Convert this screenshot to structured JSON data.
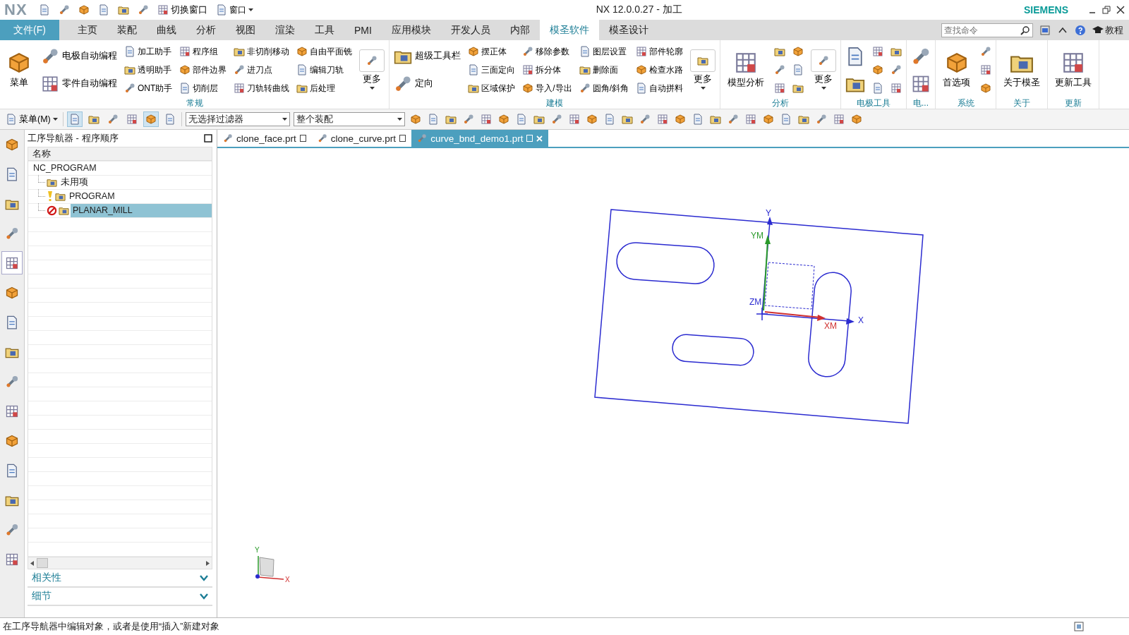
{
  "title_bar": {
    "logo": "NX",
    "switch_window": "切换窗口",
    "window_menu": "窗口",
    "title": "NX 12.0.0.27 - 加工",
    "brand": "SIEMENS"
  },
  "menu_bar": {
    "file": "文件(F)",
    "tabs": [
      {
        "label": "主页",
        "selected": false
      },
      {
        "label": "装配",
        "selected": false
      },
      {
        "label": "曲线",
        "selected": false
      },
      {
        "label": "分析",
        "selected": false
      },
      {
        "label": "视图",
        "selected": false
      },
      {
        "label": "渲染",
        "selected": false
      },
      {
        "label": "工具",
        "selected": false
      },
      {
        "label": "PMI",
        "selected": false
      },
      {
        "label": "应用模块",
        "selected": false
      },
      {
        "label": "开发人员",
        "selected": false
      },
      {
        "label": "内部",
        "selected": false
      },
      {
        "label": "模圣软件",
        "selected": true
      },
      {
        "label": "模圣设计",
        "selected": false
      }
    ],
    "search": {
      "placeholder": "查找命令"
    },
    "tutorial": "教程"
  },
  "ribbon": {
    "groups": [
      {
        "label": "常规",
        "columns": [
          [
            {
              "kind": "large",
              "label": "菜单"
            }
          ],
          [
            {
              "kind": "medium",
              "label": "电极自动编程"
            },
            {
              "kind": "medium",
              "label": "零件自动编程"
            }
          ],
          [
            {
              "kind": "small",
              "label": "加工助手"
            },
            {
              "kind": "small",
              "label": "透明助手"
            },
            {
              "kind": "small",
              "label": "ONT助手"
            }
          ],
          [
            {
              "kind": "small",
              "label": "程序组"
            },
            {
              "kind": "small",
              "label": "部件边界"
            },
            {
              "kind": "small",
              "label": "切削层"
            }
          ],
          [
            {
              "kind": "small",
              "label": "非切削移动"
            },
            {
              "kind": "small",
              "label": "进刀点"
            },
            {
              "kind": "small",
              "label": "刀轨转曲线"
            }
          ],
          [
            {
              "kind": "small",
              "label": "自由平面铣"
            },
            {
              "kind": "small",
              "label": "编辑刀轨"
            },
            {
              "kind": "small",
              "label": "后处理"
            }
          ],
          [
            {
              "kind": "more",
              "label": "更多"
            }
          ]
        ]
      },
      {
        "label": "建模",
        "columns": [
          [
            {
              "kind": "medium",
              "label": "超级工具栏"
            },
            {
              "kind": "medium",
              "label": "定向"
            }
          ],
          [
            {
              "kind": "small",
              "label": "摆正体"
            },
            {
              "kind": "small",
              "label": "三面定向"
            },
            {
              "kind": "small",
              "label": "区域保护"
            }
          ],
          [
            {
              "kind": "small",
              "label": "移除参数"
            },
            {
              "kind": "small",
              "label": "拆分体"
            },
            {
              "kind": "small",
              "label": "导入/导出"
            }
          ],
          [
            {
              "kind": "small",
              "label": "图层设置"
            },
            {
              "kind": "small",
              "label": "删除面"
            },
            {
              "kind": "small",
              "label": "圆角/斜角"
            }
          ],
          [
            {
              "kind": "small",
              "label": "部件轮廓"
            },
            {
              "kind": "small",
              "label": "检查水路"
            },
            {
              "kind": "small",
              "label": "自动拼料"
            }
          ],
          [
            {
              "kind": "more",
              "label": "更多"
            }
          ]
        ]
      },
      {
        "label": "分析",
        "columns": [
          [
            {
              "kind": "large",
              "label": "模型分析"
            }
          ],
          [
            {
              "kind": "icon"
            },
            {
              "kind": "icon"
            },
            {
              "kind": "icon"
            }
          ],
          [
            {
              "kind": "icon"
            },
            {
              "kind": "icon"
            },
            {
              "kind": "icon"
            }
          ],
          [
            {
              "kind": "more",
              "label": "更多"
            }
          ]
        ]
      },
      {
        "label": "电极工具",
        "columns": [
          [
            {
              "kind": "bigicon"
            },
            {
              "kind": "bigicon"
            }
          ],
          [
            {
              "kind": "icon"
            },
            {
              "kind": "icon"
            },
            {
              "kind": "icon"
            }
          ],
          [
            {
              "kind": "icon"
            },
            {
              "kind": "icon"
            },
            {
              "kind": "icon"
            }
          ]
        ]
      },
      {
        "label": "电...",
        "columns": [
          [
            {
              "kind": "bigicon"
            },
            {
              "kind": "bigicon"
            }
          ]
        ]
      },
      {
        "label": "系统",
        "columns": [
          [
            {
              "kind": "large",
              "label": "首选项"
            }
          ],
          [
            {
              "kind": "icon"
            },
            {
              "kind": "icon"
            },
            {
              "kind": "icon"
            }
          ]
        ]
      },
      {
        "label": "关于",
        "columns": [
          [
            {
              "kind": "large",
              "label": "关于模圣"
            }
          ]
        ]
      },
      {
        "label": "更新",
        "columns": [
          [
            {
              "kind": "large",
              "label": "更新工具"
            }
          ]
        ]
      }
    ]
  },
  "toolbar": {
    "menu": "菜单(M)",
    "toggles": [
      {
        "on": true
      },
      {
        "on": false
      },
      {
        "on": false
      },
      {
        "on": false
      },
      {
        "on": true
      },
      {
        "on": false
      }
    ],
    "filter": "无选择过滤器",
    "scope": "整个装配"
  },
  "left_rail": [
    {
      "selected": false
    },
    {
      "selected": false
    },
    {
      "selected": false
    },
    {
      "selected": false
    },
    {
      "selected": true
    },
    {
      "selected": false
    },
    {
      "selected": false
    },
    {
      "selected": false
    },
    {
      "selected": false
    },
    {
      "selected": false
    },
    {
      "selected": false
    },
    {
      "selected": false
    },
    {
      "selected": false
    },
    {
      "selected": false
    },
    {
      "selected": false
    }
  ],
  "navigator": {
    "title": "工序导航器 - 程序顺序",
    "column": "名称",
    "tree": [
      {
        "label": "NC_PROGRAM",
        "selected": false,
        "children": [
          {
            "label": "未用项",
            "selected": false,
            "warning": false,
            "error": false
          },
          {
            "label": "PROGRAM",
            "selected": false,
            "warning": true,
            "error": false
          },
          {
            "label": "PLANAR_MILL",
            "selected": true,
            "warning": false,
            "error": true
          }
        ]
      }
    ],
    "panels": [
      {
        "label": "相关性",
        "expanded": false
      },
      {
        "label": "细节",
        "expanded": false
      }
    ]
  },
  "documents": [
    {
      "label": "clone_face.prt",
      "selected": false
    },
    {
      "label": "clone_curve.prt",
      "selected": false
    },
    {
      "label": "curve_bnd_demo1.prt",
      "selected": true
    }
  ],
  "viewport": {
    "axis_labels": {
      "y": "Y",
      "ym": "YM",
      "zm": "ZM",
      "xm": "XM",
      "x": "X"
    },
    "triad": {
      "y": "Y",
      "x": "X"
    }
  },
  "status_bar": {
    "message": "在工序导航器中编辑对象，或者是使用“插入”新建对象"
  }
}
